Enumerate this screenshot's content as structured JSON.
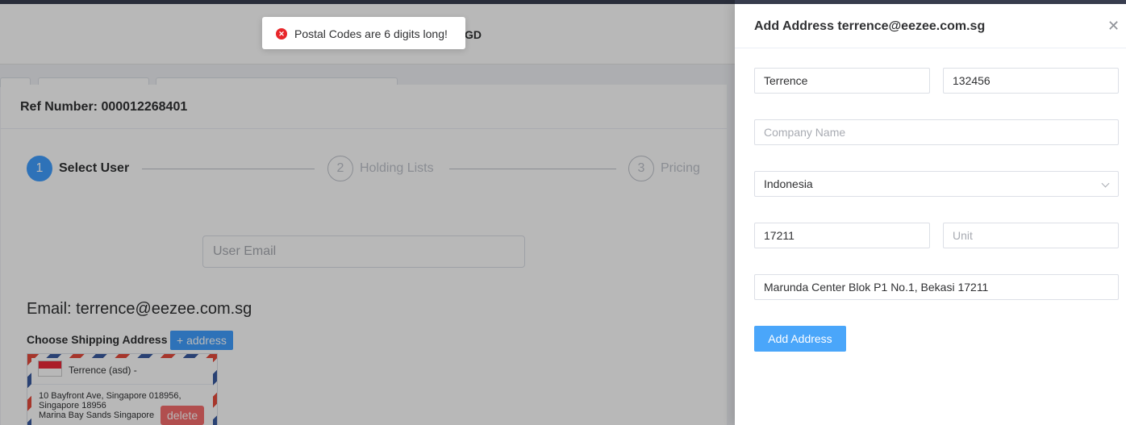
{
  "background": {
    "header_text": "GD"
  },
  "dialog": {
    "ref_number": "Ref Number: 000012268401",
    "steps": [
      {
        "index": "1",
        "label": "Select User",
        "active": true
      },
      {
        "index": "2",
        "label": "Holding Lists",
        "active": false
      },
      {
        "index": "3",
        "label": "Pricing",
        "active": false
      }
    ],
    "user_email_placeholder": "User Email",
    "email_heading": "Email: terrence@eezee.com.sg",
    "shipping_label": "Choose Shipping Address",
    "add_address_button": "+ address",
    "address_card": {
      "name": "Terrence (asd) -",
      "line1": "10 Bayfront Ave, Singapore 018956,",
      "line2": "Singapore 18956",
      "line3": "Marina Bay Sands Singapore",
      "delete_button": "delete"
    }
  },
  "drawer": {
    "title": "Add Address terrence@eezee.com.sg",
    "close_icon": "close-icon",
    "name_value": "Terrence",
    "phone_value": "132456",
    "company_placeholder": "Company Name",
    "company_value": "",
    "country_selected": "Indonesia",
    "postal_value": "17211",
    "unit_placeholder": "Unit",
    "unit_value": "",
    "address_value": "Marunda Center Blok P1 No.1, Bekasi 17211",
    "submit_button": "Add Address"
  },
  "toast": {
    "message": "Postal Codes are 6 digits long!",
    "icon": "error-icon",
    "color": "#e8262a"
  },
  "colors": {
    "primary": "#409eff",
    "danger": "#f56c6c",
    "topbar": "#3a3f51"
  }
}
